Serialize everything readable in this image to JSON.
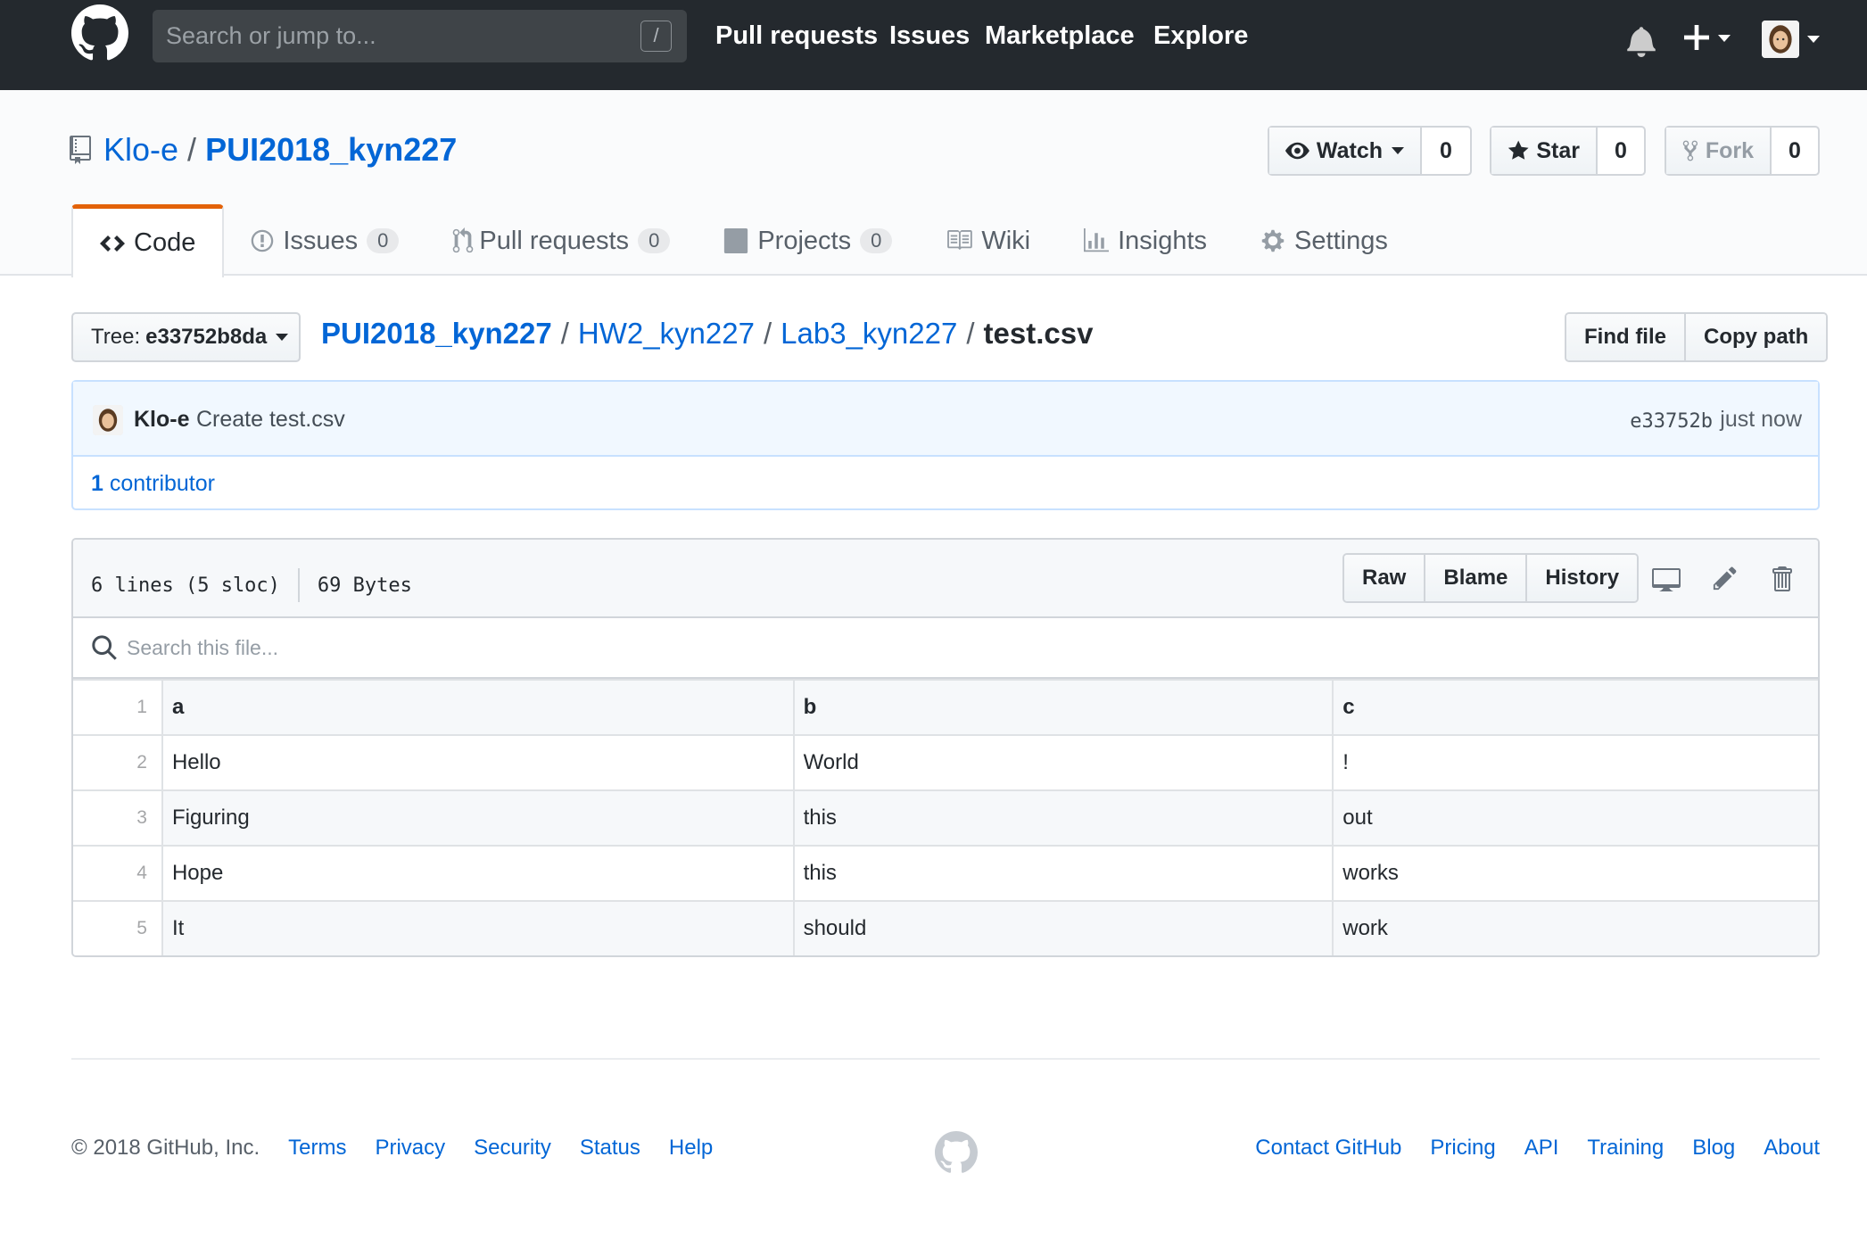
{
  "header": {
    "search_placeholder": "Search or jump to...",
    "search_shortcut": "/",
    "nav": [
      "Pull requests",
      "Issues",
      "Marketplace",
      "Explore"
    ]
  },
  "repo": {
    "owner": "Klo-e",
    "sep": "/",
    "name": "PUI2018_kyn227",
    "watch_label": "Watch",
    "watch_count": "0",
    "star_label": "Star",
    "star_count": "0",
    "fork_label": "Fork",
    "fork_count": "0"
  },
  "tabs": [
    {
      "label": "Code",
      "icon": "code-icon"
    },
    {
      "label": "Issues",
      "counter": "0",
      "icon": "issue-icon"
    },
    {
      "label": "Pull requests",
      "counter": "0",
      "icon": "pull-request-icon"
    },
    {
      "label": "Projects",
      "counter": "0",
      "icon": "project-icon"
    },
    {
      "label": "Wiki",
      "icon": "book-icon"
    },
    {
      "label": "Insights",
      "icon": "graph-icon"
    },
    {
      "label": "Settings",
      "icon": "gear-icon"
    }
  ],
  "filenav": {
    "tree_label": "Tree:",
    "tree_sha": "e33752b8da",
    "crumbs": [
      "PUI2018_kyn227",
      "HW2_kyn227",
      "Lab3_kyn227"
    ],
    "sep": "/",
    "filename": "test.csv",
    "find_file": "Find file",
    "copy_path": "Copy path"
  },
  "commit": {
    "author": "Klo-e",
    "message": "Create test.csv",
    "sha": "e33752b",
    "time": "just now",
    "contributors_count": "1",
    "contributors_label": "contributor"
  },
  "file": {
    "lines": "6 lines (5 sloc)",
    "size": "69 Bytes",
    "raw": "Raw",
    "blame": "Blame",
    "history": "History",
    "search_placeholder": "Search this file...",
    "rows": [
      {
        "n": "1",
        "cells": [
          "a",
          "b",
          "c"
        ]
      },
      {
        "n": "2",
        "cells": [
          "Hello",
          "World",
          "!"
        ]
      },
      {
        "n": "3",
        "cells": [
          "Figuring",
          "this",
          "out"
        ]
      },
      {
        "n": "4",
        "cells": [
          "Hope",
          "this",
          "works"
        ]
      },
      {
        "n": "5",
        "cells": [
          "It",
          "should",
          "work"
        ]
      }
    ]
  },
  "footer": {
    "copyright": "© 2018 GitHub, Inc.",
    "left_links": [
      "Terms",
      "Privacy",
      "Security",
      "Status",
      "Help"
    ],
    "right_links": [
      "Contact GitHub",
      "Pricing",
      "API",
      "Training",
      "Blog",
      "About"
    ]
  },
  "colors": {
    "header_bg": "#24292e",
    "link": "#0366d6",
    "tab_accent": "#e36209"
  }
}
